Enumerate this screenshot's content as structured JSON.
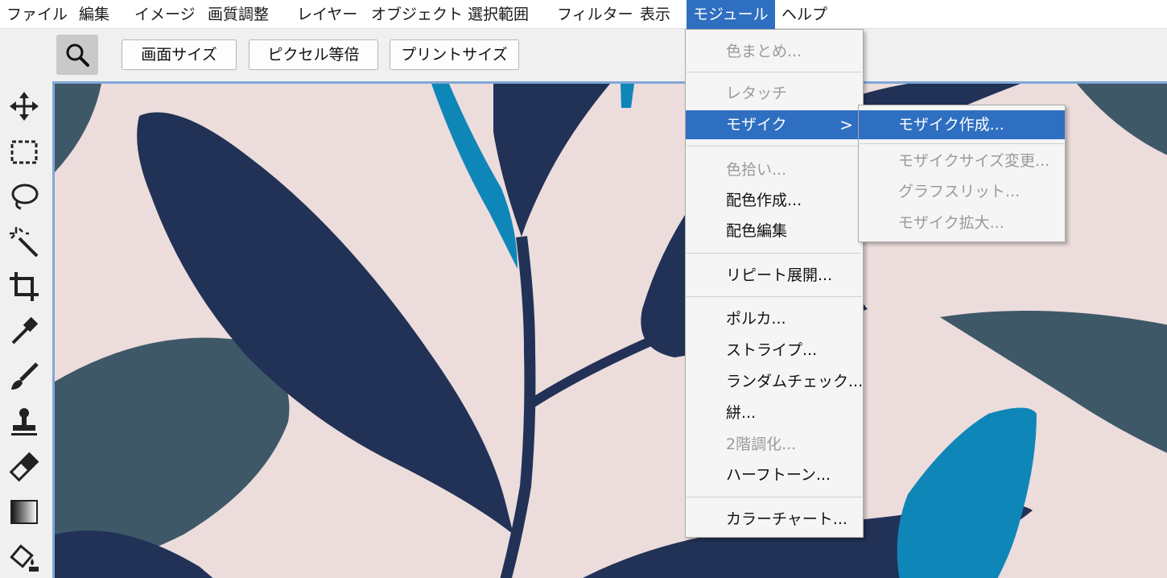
{
  "menubar": {
    "items": [
      "ファイル",
      "編集",
      "イメージ",
      "画質調整",
      "レイヤー",
      "オブジェクト",
      "選択範囲",
      "フィルター",
      "表示",
      "モジュール",
      "ヘルプ"
    ],
    "active_index": 9
  },
  "toolbar": {
    "zoom_icon": "magnifier-icon",
    "buttons": [
      "画面サイズ",
      "ピクセル等倍",
      "プリントサイズ"
    ]
  },
  "tools": [
    "move-icon",
    "rect-select-icon",
    "lasso-icon",
    "magic-wand-icon",
    "crop-icon",
    "eyedropper-icon",
    "brush-icon",
    "stamp-icon",
    "eraser-icon",
    "gradient-icon",
    "bucket-icon"
  ],
  "module_menu": {
    "items": [
      {
        "label": "色まとめ...",
        "enabled": false
      },
      {
        "label": "レタッチ",
        "enabled": false
      },
      {
        "label": "モザイク",
        "enabled": true,
        "highlighted": true,
        "has_submenu": true,
        "chevron": ">"
      },
      {
        "label": "色拾い...",
        "enabled": false
      },
      {
        "label": "配色作成...",
        "enabled": true
      },
      {
        "label": "配色編集",
        "enabled": true
      },
      {
        "label": "リピート展開...",
        "enabled": true
      },
      {
        "label": "ポルカ...",
        "enabled": true
      },
      {
        "label": "ストライプ...",
        "enabled": true
      },
      {
        "label": "ランダムチェック...",
        "enabled": true
      },
      {
        "label": "絣...",
        "enabled": true
      },
      {
        "label": "2階調化...",
        "enabled": false
      },
      {
        "label": "ハーフトーン...",
        "enabled": true
      },
      {
        "label": "カラーチャート...",
        "enabled": true
      }
    ]
  },
  "mosaic_submenu": {
    "items": [
      {
        "label": "モザイク作成...",
        "enabled": true,
        "highlighted": true
      },
      {
        "label": "モザイクサイズ変更...",
        "enabled": false
      },
      {
        "label": "グラフスリット...",
        "enabled": false
      },
      {
        "label": "モザイク拡大...",
        "enabled": false
      }
    ]
  },
  "colors": {
    "accent": "#2f6fc1",
    "canvas_bg": "#ecdcdc",
    "navy": "#213256",
    "slate": "#3e5868",
    "cyan": "#0f86b8"
  }
}
